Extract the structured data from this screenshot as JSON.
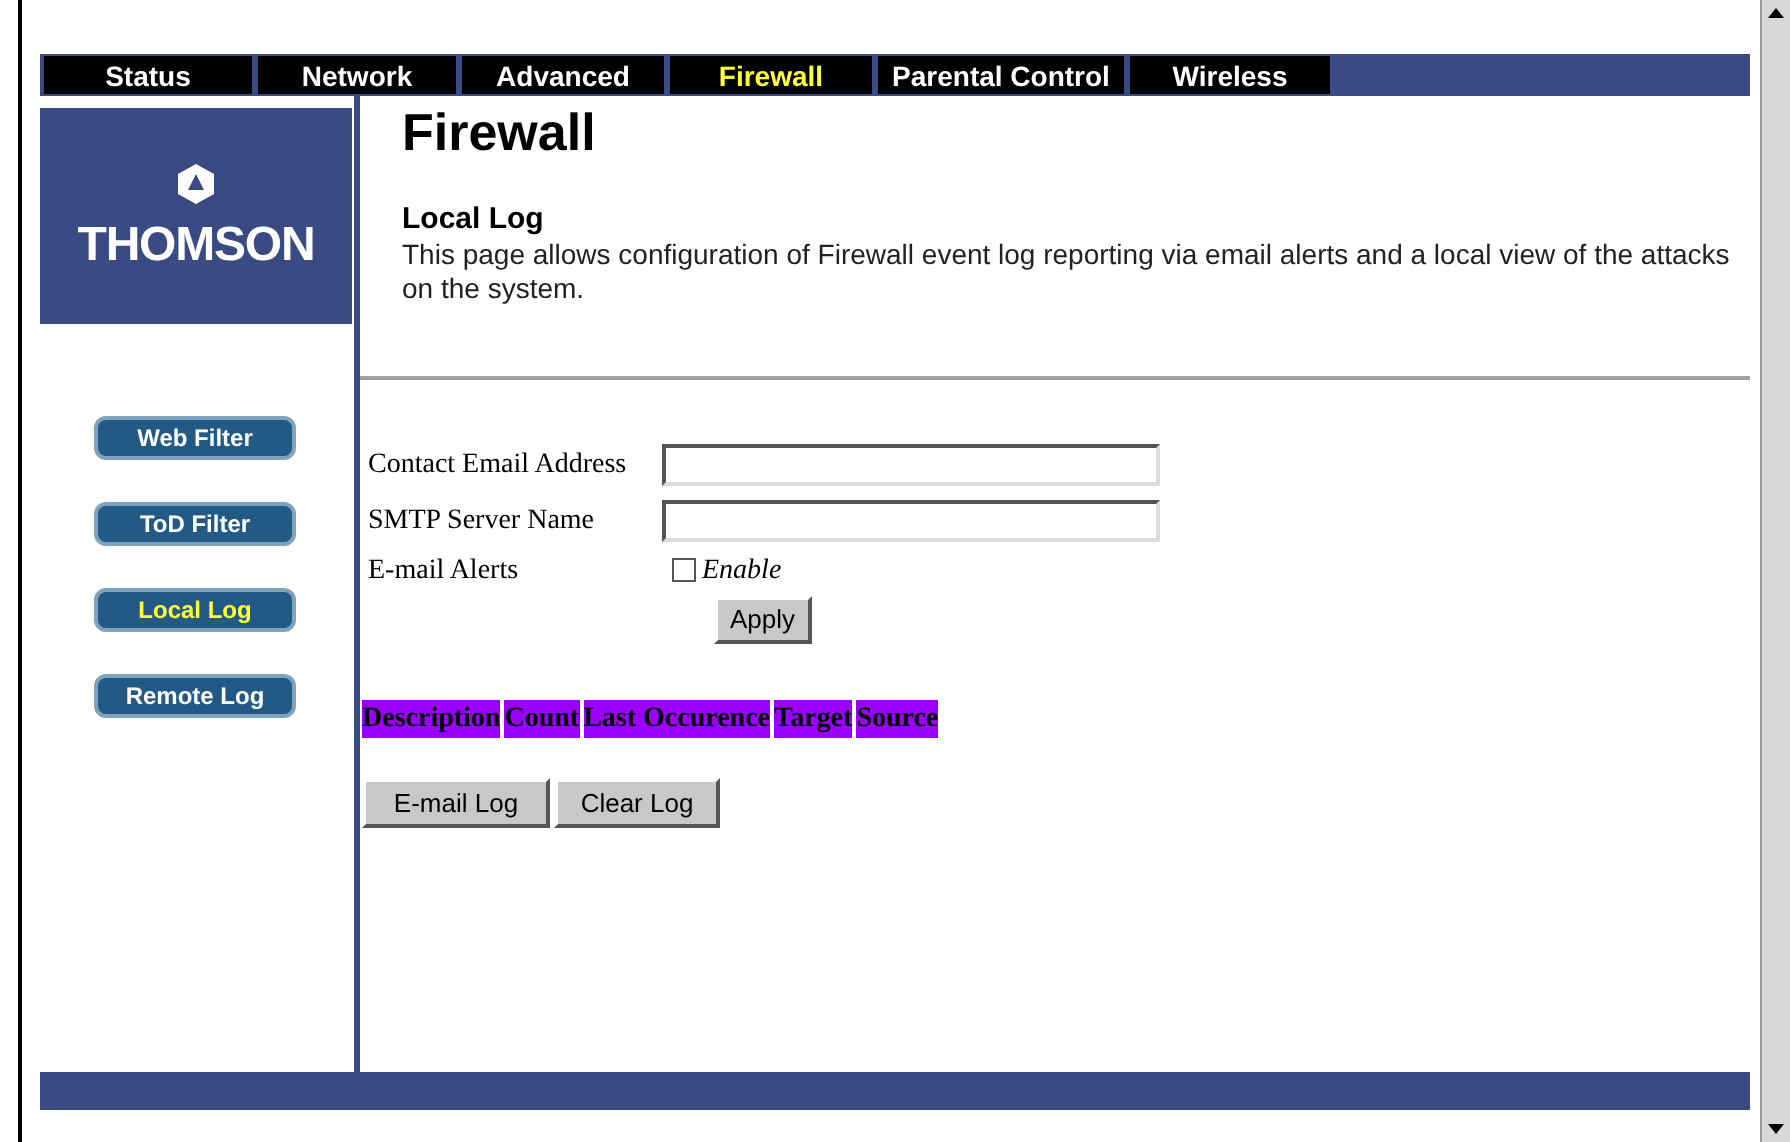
{
  "nav_tabs": [
    {
      "label": "Status",
      "selected": false
    },
    {
      "label": "Network",
      "selected": false
    },
    {
      "label": "Advanced",
      "selected": false
    },
    {
      "label": "Firewall",
      "selected": true
    },
    {
      "label": "Parental Control",
      "selected": false
    },
    {
      "label": "Wireless",
      "selected": false
    }
  ],
  "logo": {
    "text": "THOMSON"
  },
  "sidebar": {
    "items": [
      {
        "label": "Web Filter",
        "selected": false
      },
      {
        "label": "ToD Filter",
        "selected": false
      },
      {
        "label": "Local Log",
        "selected": true
      },
      {
        "label": "Remote Log",
        "selected": false
      }
    ]
  },
  "page_title": "Firewall",
  "section_title": "Local Log",
  "description": "This page allows configuration of Firewall event log reporting via email alerts and a local view of the attacks on the system.",
  "form": {
    "fields": [
      {
        "label": "Contact Email Address"
      },
      {
        "label": "SMTP Server Name"
      }
    ],
    "alerts": {
      "label": "E-mail Alerts",
      "option": "Enable",
      "checked": false
    },
    "apply_button": "Apply"
  },
  "log_table": {
    "columns": [
      "Description",
      "Count",
      "Last Occurence",
      "Target",
      "Source"
    ]
  },
  "buttons": [
    "E-mail Log",
    "Clear Log"
  ]
}
